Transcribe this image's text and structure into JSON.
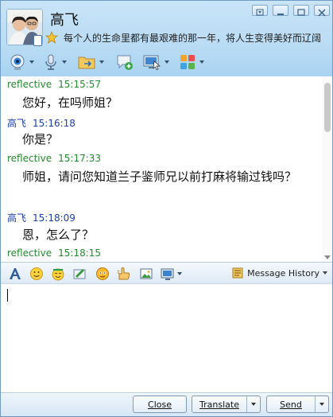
{
  "contact": {
    "name": "高飞",
    "signature": "每个人的生命里都有最艰难的那一年，将人生变得美好而辽阔"
  },
  "messages": [
    {
      "sender": "reflective",
      "time": "15:15:57",
      "text": "您好，在吗师姐？",
      "color": "#248a2f"
    },
    {
      "sender": "高飞",
      "time": "15:16:18",
      "text": "你是？",
      "color": "#1c3fb0"
    },
    {
      "sender": "reflective",
      "time": "15:17:33",
      "text": "师姐，请问您知道兰子鉴师兄以前打麻将输过钱吗？",
      "color": "#248a2f"
    },
    {
      "sender": "高飞",
      "time": "15:18:09",
      "text": "恩，怎么了？",
      "color": "#1c3fb0"
    },
    {
      "sender": "reflective",
      "time": "15:18:15",
      "text": "",
      "color": "#248a2f"
    }
  ],
  "input_toolbar": {
    "history_label": "Message History"
  },
  "buttons": {
    "close": "Close",
    "translate": "Translate",
    "send": "Send"
  },
  "icons": {
    "toolbar": [
      "webcam-icon",
      "microphone-icon",
      "transfer-file-icon",
      "send-sms-icon",
      "remote-assistance-icon",
      "apps-icon"
    ],
    "input": [
      "font-icon",
      "emoticon-icon",
      "magic-emoticon-icon",
      "handwriting-icon",
      "wink-icon",
      "nudge-icon",
      "image-icon",
      "screenshot-icon"
    ]
  }
}
